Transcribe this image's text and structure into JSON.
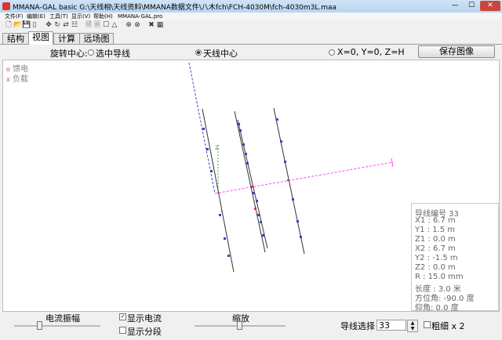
{
  "window": {
    "title": "MMANA-GAL basic G:\\天线相\\天线资料\\MMANA数据文件\\八木fch\\FCH-4030M\\fch-4030m3L.maa",
    "min": "—",
    "max": "☐",
    "close": "✕"
  },
  "menu": [
    {
      "label": "文件(F)"
    },
    {
      "label": "编辑(E)"
    },
    {
      "label": "工具(T)"
    },
    {
      "label": "显示(V)"
    },
    {
      "label": "帮助(H)"
    },
    {
      "label": "MMANA-GAL.pro"
    }
  ],
  "toolbar": {
    "icons": [
      "new-file-icon",
      "open-folder-icon",
      "save-icon",
      "copy-icon",
      "move-icon",
      "rotate-icon",
      "stretch-icon",
      "table-icon",
      "page-icon",
      "page2-icon",
      "box-icon",
      "triangle-icon",
      "target-icon",
      "zoom-icon",
      "tools-icon",
      "calc-icon"
    ],
    "glyphs": [
      "🗋",
      "📂",
      "💾",
      "▯",
      "✥",
      "↻",
      "⇄",
      "☷",
      "🗎",
      "🗏",
      "☐",
      "△",
      "⊕",
      "⊗",
      "✖",
      "▦"
    ]
  },
  "tabs": [
    {
      "label": "结构",
      "active": false
    },
    {
      "label": "视图",
      "active": true
    },
    {
      "label": "计算",
      "active": false
    },
    {
      "label": "远场图",
      "active": false
    }
  ],
  "rotation": {
    "label": "旋转中心:",
    "options": [
      {
        "label": "选中导线",
        "selected": false
      },
      {
        "label": "天线中心",
        "selected": true
      },
      {
        "label": "X=0, Y=0, Z=H",
        "selected": false
      }
    ]
  },
  "save_image": "保存图像",
  "legend": [
    {
      "marker": "o",
      "label": "馈电"
    },
    {
      "marker": "x",
      "label": "负载"
    }
  ],
  "view": {
    "z_label": "Z",
    "colors": {
      "wire": "#333333",
      "segment": "#4040c0",
      "axis_x": "#ff44ff",
      "axis_y": "#4444cc",
      "axis_z": "#44aa44",
      "current": "#dd3333"
    }
  },
  "info": [
    "导线编号 33",
    "X1   :  6.7 m",
    "Y1   :  1.5 m",
    "Z1   :  0.0 m",
    "X2   :  6.7 m",
    "Y2   :  -1.5 m",
    "Z2   :  0.0 m",
    "R    :  15.0 mm",
    "长度 : 3.0 米",
    "方位角: -90.0 度",
    "仰角:  0.0 度"
  ],
  "bottom": {
    "current_amp": "电流振幅",
    "show_current": "显示电流",
    "show_current_checked": true,
    "show_segments": "显示分段",
    "show_segments_checked": false,
    "zoom": "缩放",
    "wire_select": "导线选择",
    "wire_value": "33",
    "bold": "粗细 x 2",
    "bold_checked": false
  }
}
